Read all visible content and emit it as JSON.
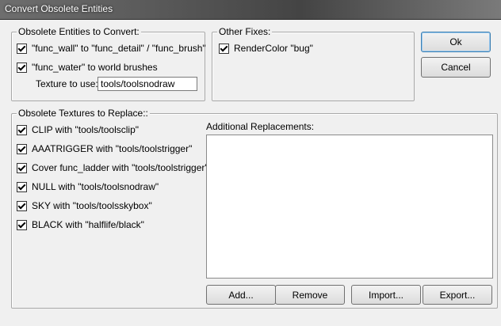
{
  "window": {
    "title": "Convert Obsolete Entities"
  },
  "entities_group": {
    "legend": "Obsolete Entities to Convert:",
    "func_wall_label": "\"func_wall\" to \"func_detail\" / \"func_brush\"",
    "func_water_label": "\"func_water\" to world brushes",
    "texture_label": "Texture to use:",
    "texture_value": "tools/toolsnodraw"
  },
  "other_fixes": {
    "legend": "Other Fixes:",
    "rendercolor_label": "RenderColor \"bug\""
  },
  "buttons": {
    "ok": "Ok",
    "cancel": "Cancel",
    "add": "Add...",
    "remove": "Remove",
    "import": "Import...",
    "export": "Export..."
  },
  "textures_group": {
    "legend": "Obsolete Textures to Replace::",
    "items": [
      "CLIP with \"tools/toolsclip\"",
      "AAATRIGGER with \"tools/toolstrigger\"",
      "Cover func_ladder with \"tools/toolstrigger\"",
      "NULL with \"tools/toolsnodraw\"",
      "SKY with \"tools/toolsskybox\"",
      "BLACK with \"halflife/black\""
    ],
    "additional_label": "Additional Replacements:"
  }
}
